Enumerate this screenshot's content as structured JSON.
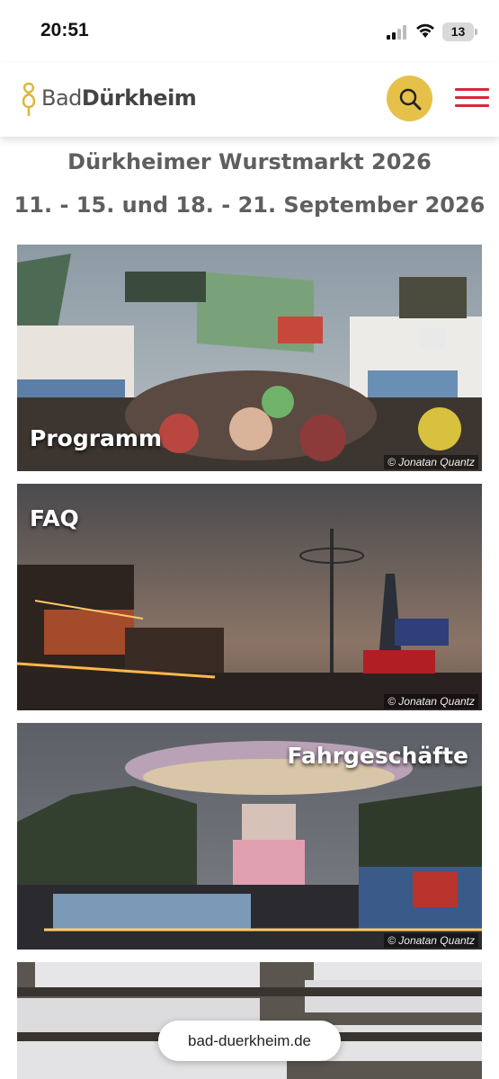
{
  "status_bar": {
    "time": "20:51",
    "battery": "13"
  },
  "header": {
    "logo_light": "Bad",
    "logo_bold": "Dürkheim",
    "search_icon": "search-icon",
    "menu_icon": "hamburger-menu-icon",
    "accent": "#e5c14a",
    "menu_color": "#d8273a"
  },
  "main": {
    "title": "Dürkheimer Wurstmarkt 2026",
    "dates": "11. - 15. und 18. - 21. September 2026",
    "cards": [
      {
        "label": "Programm",
        "credit": "© Jonatan Quantz"
      },
      {
        "label": "FAQ",
        "credit": "© Jonatan Quantz"
      },
      {
        "label": "Fahrgeschäfte",
        "credit": "© Jonatan Quantz"
      },
      {
        "label": "",
        "credit": ""
      }
    ]
  },
  "browser": {
    "url": "bad-duerkheim.de"
  }
}
